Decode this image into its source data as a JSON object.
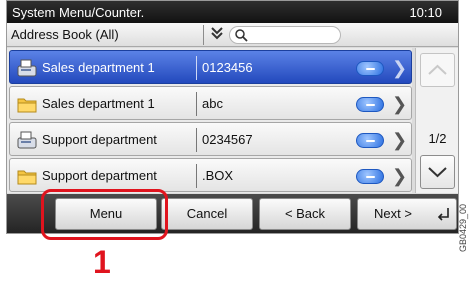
{
  "titlebar": {
    "title": "System Menu/Counter.",
    "clock": "10:10"
  },
  "addressbar": {
    "book": "Address Book (All)",
    "dropdown_icon": "double-chevron-down-icon",
    "search_icon": "search-icon"
  },
  "rows": [
    {
      "name": "Sales department 1",
      "value": "0123456",
      "icon": "fax-icon",
      "selected": true
    },
    {
      "name": "Sales department 1",
      "value": "abc",
      "icon": "folder-icon",
      "selected": false
    },
    {
      "name": "Support department",
      "value": "0234567",
      "icon": "fax-icon",
      "selected": false
    },
    {
      "name": "Support department",
      "value": ".BOX",
      "icon": "folder-icon",
      "selected": false
    }
  ],
  "pager": {
    "page": "1/2"
  },
  "buttons": {
    "menu": "Menu",
    "cancel": "Cancel",
    "back": "< Back",
    "next": "Next >"
  },
  "callout": "1",
  "figure_code": "GB0429_00",
  "colors": {
    "selected": "#2f57d1",
    "callout": "#e0141e"
  }
}
